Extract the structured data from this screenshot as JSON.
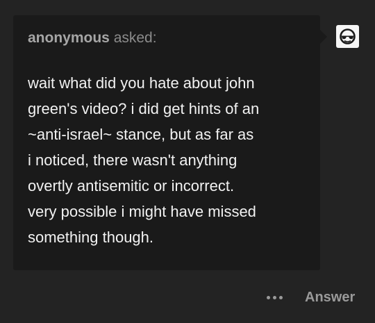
{
  "ask": {
    "asker_name": "anonymous",
    "asker_suffix": " asked:",
    "question": "wait what did you hate about john\ngreen's video? i did get hints of an\n~anti-israel~ stance, but as far as\ni noticed, there wasn't anything\novertly antisemitic or incorrect.\nvery possible i might have missed\nsomething though.",
    "avatar_icon": "anonymous-sunglasses-icon"
  },
  "actions": {
    "more_icon": "more-options-icon",
    "answer_label": "Answer"
  },
  "colors": {
    "page_background": "#232323",
    "card_background": "#1a1a1a",
    "question_text": "#f2f2f2",
    "muted_text": "#9a9a9a"
  }
}
